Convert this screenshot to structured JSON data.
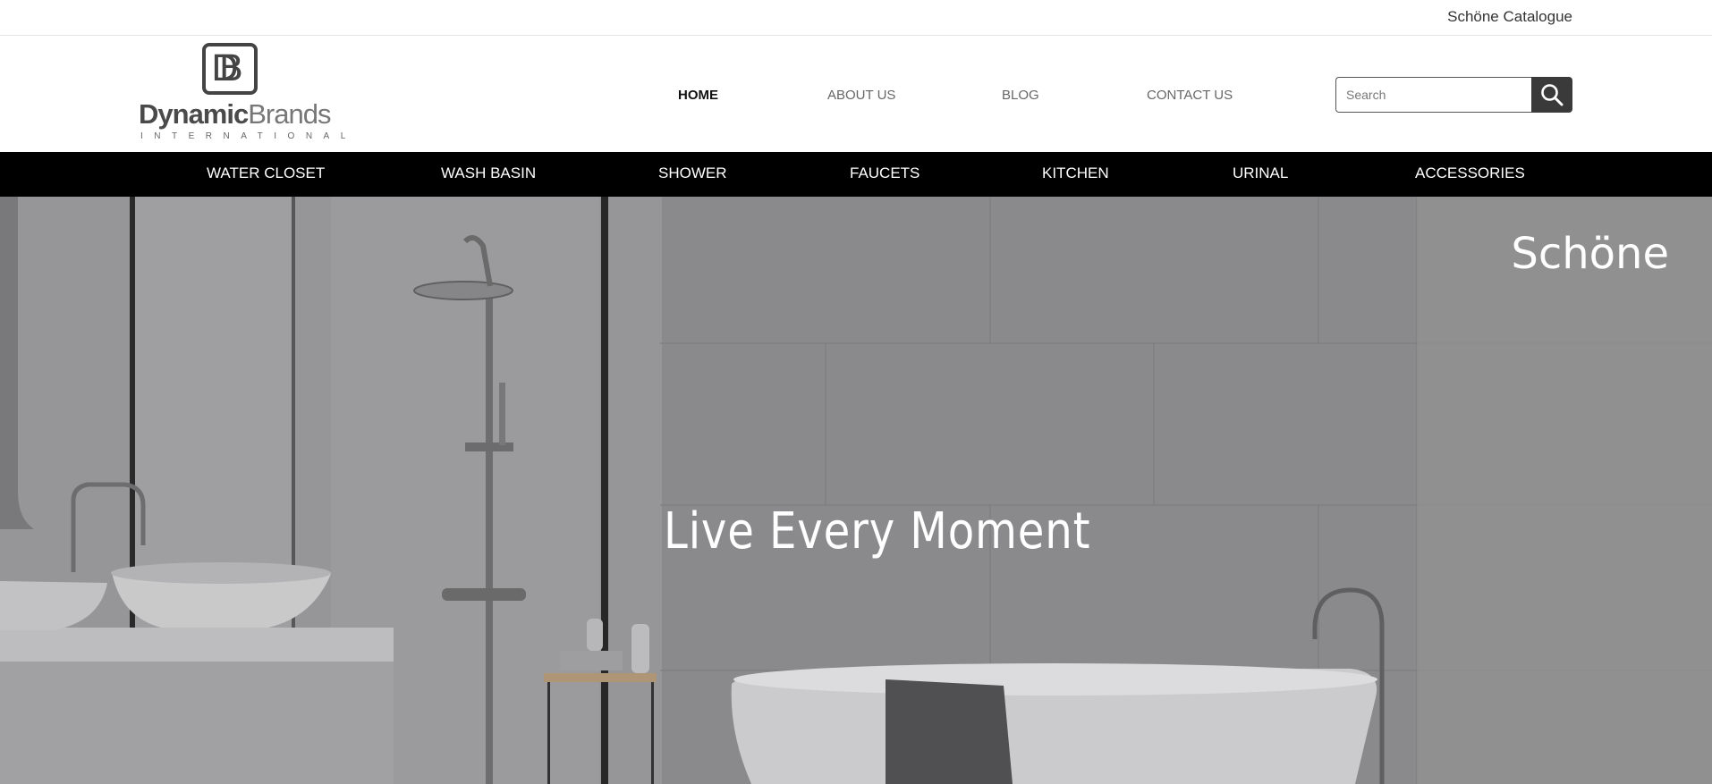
{
  "topbar": {
    "catalogue_link": "Schöne Catalogue"
  },
  "logo": {
    "mark": "DB",
    "word_bold": "Dynamic",
    "word_light": "Brands",
    "tagline": "INTERNATIONAL"
  },
  "nav": {
    "items": [
      {
        "label": "HOME",
        "active": true
      },
      {
        "label": "ABOUT US",
        "active": false
      },
      {
        "label": "BLOG",
        "active": false
      },
      {
        "label": "CONTACT US",
        "active": false
      }
    ]
  },
  "search": {
    "placeholder": "Search",
    "value": ""
  },
  "categories": [
    "WATER CLOSET",
    "WASH BASIN",
    "SHOWER",
    "FAUCETS",
    "KITCHEN",
    "URINAL",
    "ACCESSORIES"
  ],
  "hero": {
    "brand": "Schöne",
    "headline": "Live Every Moment"
  },
  "colors": {
    "category_bar": "#000000",
    "search_button": "#3a3a3a",
    "hero_overlay": "#8d8d8f"
  }
}
